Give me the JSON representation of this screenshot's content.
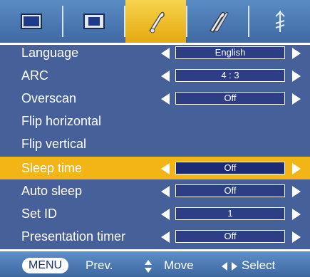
{
  "tabs": [
    {
      "icon": "picture-icon",
      "selected": false
    },
    {
      "icon": "screen-icon",
      "selected": false
    },
    {
      "icon": "option-icon",
      "selected": true
    },
    {
      "icon": "option2-icon",
      "selected": false
    },
    {
      "icon": "input-icon",
      "selected": false
    }
  ],
  "menu": [
    {
      "label": "Language",
      "value": "English"
    },
    {
      "label": "ARC",
      "value": "4 : 3"
    },
    {
      "label": "Overscan",
      "value": "Off"
    },
    {
      "label": "Flip horizontal"
    },
    {
      "label": "Flip vertical"
    },
    {
      "label": "Sleep time",
      "value": "Off"
    },
    {
      "label": "Auto sleep",
      "value": "Off"
    },
    {
      "label": "Set ID",
      "value": "1"
    },
    {
      "label": "Presentation timer",
      "value": "Off"
    }
  ],
  "selected_index": 5,
  "bottom": {
    "menu_key": "MENU",
    "prev": "Prev.",
    "move": "Move",
    "select": "Select"
  },
  "colors": {
    "panel": "#46609a",
    "highlight": "#f2b515",
    "value_box": "#2c3f85"
  }
}
